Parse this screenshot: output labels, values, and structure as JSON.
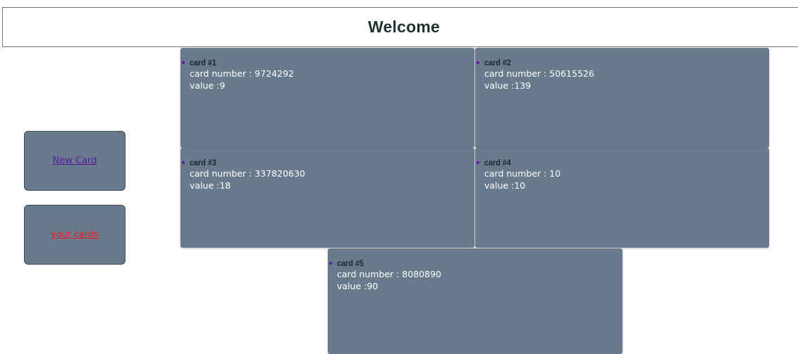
{
  "header": {
    "title": "Welcome"
  },
  "nav": {
    "new_card_label": "New Card",
    "your_cards_label": "your cards"
  },
  "cards": [
    {
      "title": "card #1",
      "number_label": "card number : 9724292",
      "value_label": "value :9"
    },
    {
      "title": "card #2",
      "number_label": "card number : 50615526",
      "value_label": "value :139"
    },
    {
      "title": "card #3",
      "number_label": "card number : 337820630",
      "value_label": "value :18"
    },
    {
      "title": "card #4",
      "number_label": "card number : 10",
      "value_label": "value :10"
    },
    {
      "title": "card #5",
      "number_label": "card number : 8080890",
      "value_label": "value :90"
    }
  ],
  "colors": {
    "card_bg": "#687a8c",
    "new_card_link": "#5a1aa0",
    "your_cards_link": "#e8202a",
    "title_text": "#1f3333"
  }
}
